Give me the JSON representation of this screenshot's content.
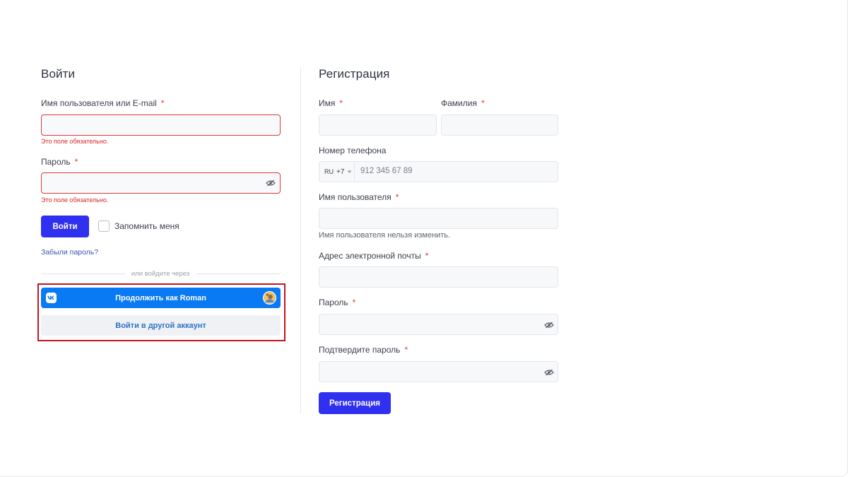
{
  "login": {
    "title": "Войти",
    "username_label": "Имя пользователя или E-mail",
    "required_mark": "*",
    "username_error": "Это поле обязательно.",
    "password_label": "Пароль",
    "password_error": "Это поле обязательно.",
    "submit_label": "Войти",
    "remember_label": "Запомнить меня",
    "remember_checked": false,
    "forgot_label": "Забыли пароль?",
    "divider_text": "или войдите через",
    "vk_continue_label": "Продолжить как Roman",
    "other_account_label": "Войти в другой аккаунт"
  },
  "register": {
    "title": "Регистрация",
    "first_name_label": "Имя",
    "last_name_label": "Фамилия",
    "phone_label": "Номер телефона",
    "phone_country": "RU",
    "phone_code": "+7",
    "phone_placeholder": "912 345 67 89",
    "username_label": "Имя пользователя",
    "username_hint": "Имя пользователя нельзя изменить.",
    "email_label": "Адрес электронной почты",
    "password_label": "Пароль",
    "confirm_password_label": "Подтвердите пароль",
    "submit_label": "Регистрация"
  },
  "colors": {
    "primary_button": "#3030f0",
    "vk_blue": "#0a79f4",
    "error": "#d3262b",
    "highlight_frame": "#c4141b"
  },
  "icons": {
    "password_toggle": "eye-slash-icon",
    "vk_logo": "vk-logo-icon",
    "avatar": "user-avatar",
    "country_dropdown": "chevron-down-icon"
  }
}
